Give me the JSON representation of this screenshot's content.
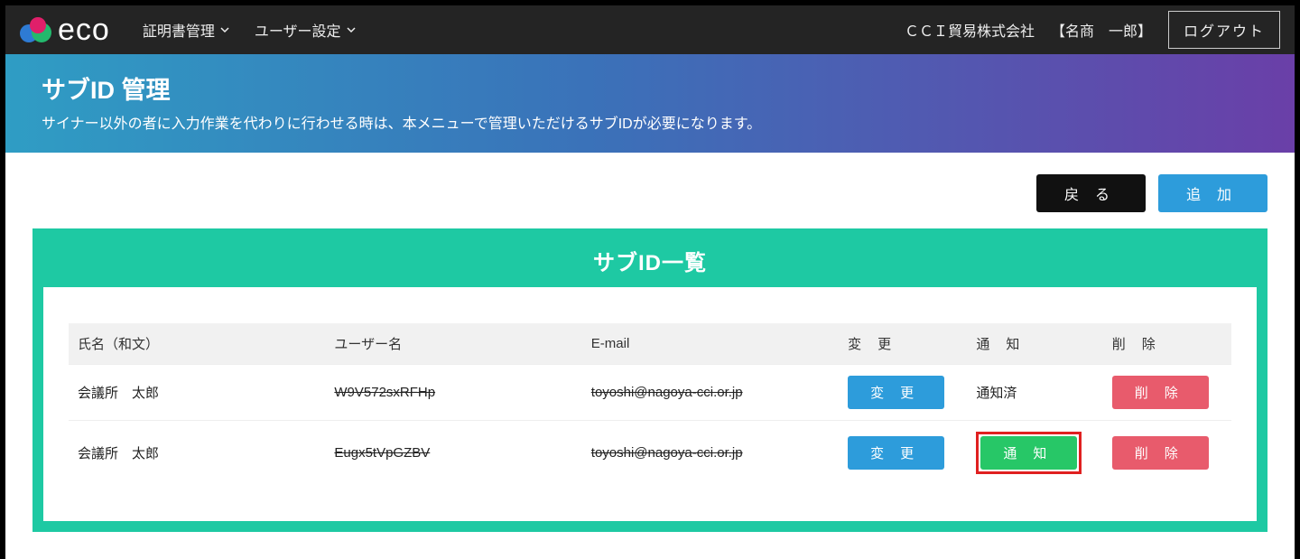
{
  "nav": {
    "menu1": "証明書管理",
    "menu2": "ユーザー設定",
    "company": "ＣＣＩ貿易株式会社",
    "username": "【名商　一郎】",
    "logout": "ログアウト"
  },
  "header": {
    "title": "サブID 管理",
    "subtitle": "サイナー以外の者に入力作業を代わりに行わせる時は、本メニューで管理いただけるサブIDが必要になります。"
  },
  "actions": {
    "back": "戻る",
    "add": "追加"
  },
  "panel": {
    "title": "サブID一覧"
  },
  "table": {
    "headers": {
      "name": "氏名（和文）",
      "username": "ユーザー名",
      "email": "E-mail",
      "change": "変更",
      "notify": "通知",
      "delete": "削除"
    },
    "buttons": {
      "change": "変更",
      "notify": "通知",
      "delete": "削除"
    },
    "rows": [
      {
        "name": "会議所　太郎",
        "username": "W9V572sxRFHp",
        "email": "toyoshi@nagoya-cci.or.jp",
        "notify_status": "通知済",
        "notify_button": false
      },
      {
        "name": "会議所　太郎",
        "username": "Eugx5tVpGZBV",
        "email": "toyoshi@nagoya-cci.or.jp",
        "notify_status": "",
        "notify_button": true
      }
    ]
  }
}
